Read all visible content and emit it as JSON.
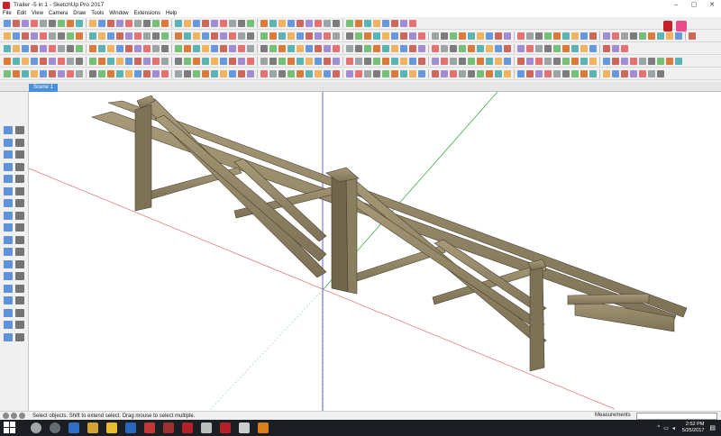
{
  "window": {
    "title": "Trailer -5 in 1 - SketchUp Pro 2017",
    "app_icon": "sketchup-logo-icon",
    "controls": [
      "–",
      "▢",
      "✕"
    ]
  },
  "menu": [
    "File",
    "Edit",
    "View",
    "Camera",
    "Draw",
    "Tools",
    "Window",
    "Extensions",
    "Help"
  ],
  "scenes": {
    "active": "Scene 1"
  },
  "viewport": {
    "model": "trailer-frame",
    "colors": {
      "wood": "#8b7f63",
      "wood_light": "#a89a78",
      "wood_dark": "#5c533f",
      "axis_red": "#e07070",
      "axis_green": "#3cb04a",
      "axis_blue": "#3b3bd6"
    }
  },
  "status": {
    "hint": "Select objects. Shift to extend select. Drag mouse to select multiple.",
    "measurements_label": "Measurements",
    "measurements_value": ""
  },
  "taskbar": {
    "clock_time": "2:52 PM",
    "clock_date": "5/25/2017",
    "items": [
      "search-icon",
      "task-view-icon",
      "edge-icon",
      "chrome-icon",
      "file-explorer-icon",
      "store-icon",
      "m-app-icon",
      "m-app-2-icon",
      "sketchup-icon",
      "media-icon",
      "layout-icon",
      "style-builder-icon",
      "vlc-icon"
    ]
  }
}
